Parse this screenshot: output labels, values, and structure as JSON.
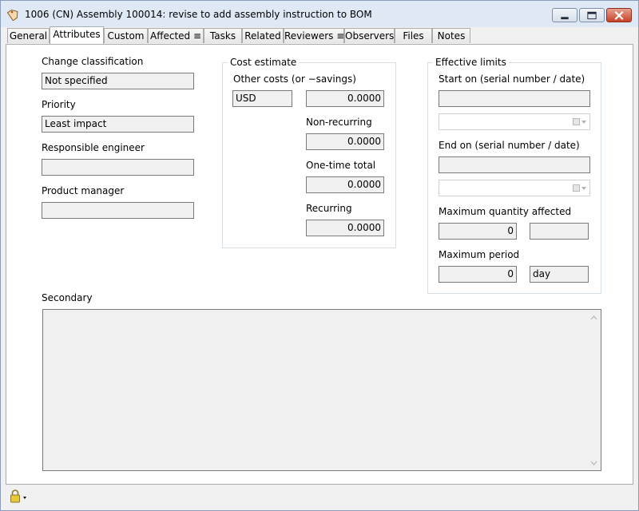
{
  "window": {
    "title": "1006 (CN) Assembly 100014: revise to add assembly instruction to BOM",
    "app_icon": "tag-icon",
    "controls": [
      "minimize-icon",
      "maximize-icon",
      "close-icon"
    ]
  },
  "tabs": [
    {
      "label": "General"
    },
    {
      "label": "Attributes",
      "active": true
    },
    {
      "label": "Custom"
    },
    {
      "label": "Affected ≡"
    },
    {
      "label": "Tasks"
    },
    {
      "label": "Related"
    },
    {
      "label": "Reviewers ≡"
    },
    {
      "label": "Observers"
    },
    {
      "label": "Files"
    },
    {
      "label": "Notes"
    }
  ],
  "left": {
    "change_classification_label": "Change classification",
    "change_classification_value": "Not specified",
    "priority_label": "Priority",
    "priority_value": "Least impact",
    "responsible_engineer_label": "Responsible engineer",
    "responsible_engineer_value": "",
    "product_manager_label": "Product manager",
    "product_manager_value": ""
  },
  "cost": {
    "group_title": "Cost estimate",
    "other_costs_label": "Other costs (or −savings)",
    "currency": "USD",
    "other_costs_value": "0.0000",
    "non_recurring_label": "Non-recurring",
    "non_recurring_value": "0.0000",
    "one_time_total_label": "One-time total",
    "one_time_total_value": "0.0000",
    "recurring_label": "Recurring",
    "recurring_value": "0.0000"
  },
  "limits": {
    "group_title": "Effective limits",
    "start_on_label": "Start on (serial number / date)",
    "start_on_serial": "",
    "start_on_date": "",
    "end_on_label": "End on (serial number / date)",
    "end_on_serial": "",
    "end_on_date": "",
    "max_qty_label": "Maximum quantity affected",
    "max_qty_value": "0",
    "max_qty_unit": "",
    "max_period_label": "Maximum period",
    "max_period_value": "0",
    "max_period_unit": "day"
  },
  "secondary": {
    "label": "Secondary",
    "value": ""
  },
  "status": {
    "lock_icon": "padlock-icon"
  }
}
